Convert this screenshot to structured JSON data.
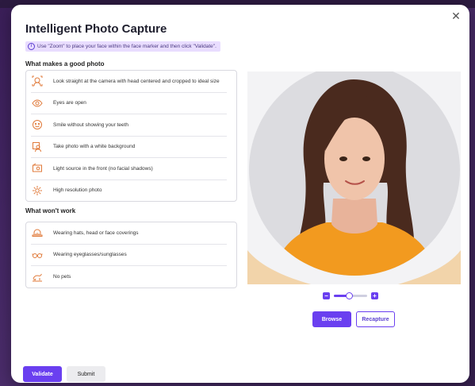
{
  "dialog": {
    "title": "Intelligent Photo Capture",
    "hint": "Use \"Zoom\" to place your face within the face marker and then click \"Validate\".",
    "close_icon": "close-icon"
  },
  "good": {
    "heading": "What makes a good photo",
    "items": [
      {
        "label": "Look straight at the camera with head centered and cropped to ideal size",
        "icon": "head-center-icon"
      },
      {
        "label": "Eyes are open",
        "icon": "eye-icon"
      },
      {
        "label": "Smile without showing your teeth",
        "icon": "smile-icon"
      },
      {
        "label": "Take photo with a white background",
        "icon": "white-background-icon"
      },
      {
        "label": "Light source in the front (no facial shadows)",
        "icon": "light-source-icon"
      },
      {
        "label": "High resolution photo",
        "icon": "sparkle-icon"
      }
    ]
  },
  "bad": {
    "heading": "What won't work",
    "items": [
      {
        "label": "Wearing hats, head or face coverings",
        "icon": "hat-icon"
      },
      {
        "label": "Wearing eyeglasses/sunglasses",
        "icon": "glasses-icon"
      },
      {
        "label": "No pets",
        "icon": "pet-icon"
      }
    ]
  },
  "zoom": {
    "minus": "−",
    "plus": "+",
    "level": 0.45
  },
  "actions": {
    "browse": "Browse",
    "recapture": "Recapture",
    "validate": "Validate",
    "submit": "Submit"
  },
  "colors": {
    "accent": "#6a3ff0",
    "icon": "#e07a3a",
    "shirt": "#f29a1f",
    "hair": "#4a2a1e"
  }
}
